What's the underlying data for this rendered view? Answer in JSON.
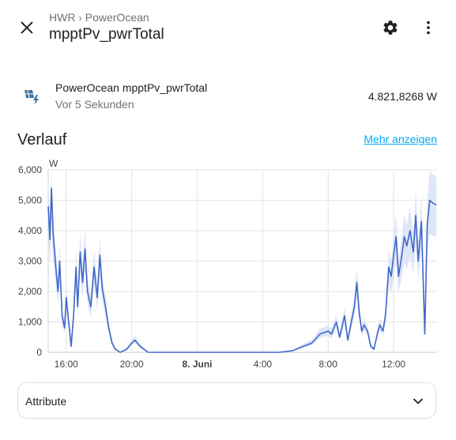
{
  "header": {
    "breadcrumb": [
      "HWR",
      "PowerOcean"
    ],
    "breadcrumb_separator": "›",
    "title": "mpptPv_pwrTotal",
    "icons": {
      "close": "close-icon",
      "settings": "gear-icon",
      "more": "more-vertical-icon"
    }
  },
  "entity": {
    "name": "PowerOcean mpptPv_pwrTotal",
    "last_changed": "Vor 5 Sekunden",
    "value": "4.821,8268 W",
    "icon": "solar-power-icon",
    "icon_color": "#44739e"
  },
  "history": {
    "title": "Verlauf",
    "more_link": "Mehr anzeigen"
  },
  "chart_data": {
    "type": "line",
    "ylabel": "W",
    "ylim": [
      0,
      6000
    ],
    "yticks": [
      "6,000",
      "5,000",
      "4,000",
      "3,000",
      "2,000",
      "1,000",
      "0"
    ],
    "yticks_values": [
      6000,
      5000,
      4000,
      3000,
      2000,
      1000,
      0
    ],
    "xlim_hours": [
      14.9,
      38.65
    ],
    "xticks": [
      {
        "label": "16:00",
        "hour": 16,
        "bold": false
      },
      {
        "label": "20:00",
        "hour": 20,
        "bold": false
      },
      {
        "label": "8. Juni",
        "hour": 24,
        "bold": true
      },
      {
        "label": "4:00",
        "hour": 28,
        "bold": false
      },
      {
        "label": "8:00",
        "hour": 32,
        "bold": false
      },
      {
        "label": "12:00",
        "hour": 36,
        "bold": false
      }
    ],
    "grid": true,
    "line_color": "#3f68c9",
    "band_color": "#dbe3f6",
    "series": [
      {
        "values": [
          [
            14.9,
            4800
          ],
          [
            15.0,
            3700
          ],
          [
            15.1,
            5400
          ],
          [
            15.2,
            3900
          ],
          [
            15.35,
            2900
          ],
          [
            15.5,
            2000
          ],
          [
            15.6,
            3000
          ],
          [
            15.75,
            1200
          ],
          [
            15.9,
            800
          ],
          [
            16.0,
            1800
          ],
          [
            16.15,
            1000
          ],
          [
            16.3,
            200
          ],
          [
            16.45,
            1200
          ],
          [
            16.6,
            2800
          ],
          [
            16.7,
            1500
          ],
          [
            16.85,
            3300
          ],
          [
            17.0,
            2300
          ],
          [
            17.15,
            3400
          ],
          [
            17.3,
            2000
          ],
          [
            17.5,
            1500
          ],
          [
            17.7,
            2800
          ],
          [
            17.9,
            1800
          ],
          [
            18.05,
            3200
          ],
          [
            18.2,
            2100
          ],
          [
            18.4,
            1500
          ],
          [
            18.6,
            800
          ],
          [
            18.8,
            300
          ],
          [
            19.0,
            100
          ],
          [
            19.3,
            0
          ],
          [
            19.7,
            100
          ],
          [
            20.0,
            300
          ],
          [
            20.2,
            400
          ],
          [
            20.5,
            200
          ],
          [
            21.0,
            0
          ],
          [
            24.0,
            0
          ],
          [
            29.0,
            0
          ],
          [
            29.8,
            50
          ],
          [
            30.5,
            200
          ],
          [
            31.0,
            300
          ],
          [
            31.5,
            600
          ],
          [
            32.0,
            700
          ],
          [
            32.2,
            600
          ],
          [
            32.5,
            1000
          ],
          [
            32.7,
            500
          ],
          [
            33.0,
            1200
          ],
          [
            33.2,
            400
          ],
          [
            33.45,
            1100
          ],
          [
            33.6,
            1500
          ],
          [
            33.75,
            2300
          ],
          [
            33.9,
            1300
          ],
          [
            34.05,
            700
          ],
          [
            34.2,
            900
          ],
          [
            34.4,
            700
          ],
          [
            34.6,
            200
          ],
          [
            34.8,
            100
          ],
          [
            35.0,
            600
          ],
          [
            35.15,
            900
          ],
          [
            35.35,
            700
          ],
          [
            35.5,
            1200
          ],
          [
            35.7,
            2800
          ],
          [
            35.85,
            2500
          ],
          [
            36.0,
            3200
          ],
          [
            36.15,
            3800
          ],
          [
            36.3,
            2500
          ],
          [
            36.5,
            3200
          ],
          [
            36.65,
            3800
          ],
          [
            36.8,
            3500
          ],
          [
            37.0,
            4000
          ],
          [
            37.2,
            3300
          ],
          [
            37.35,
            4500
          ],
          [
            37.5,
            3000
          ],
          [
            37.7,
            4300
          ],
          [
            37.9,
            600
          ],
          [
            38.05,
            4200
          ],
          [
            38.2,
            5000
          ],
          [
            38.4,
            4900
          ],
          [
            38.6,
            4850
          ]
        ]
      }
    ]
  },
  "attributes": {
    "label": "Attribute",
    "icon": "chevron-down-icon"
  }
}
